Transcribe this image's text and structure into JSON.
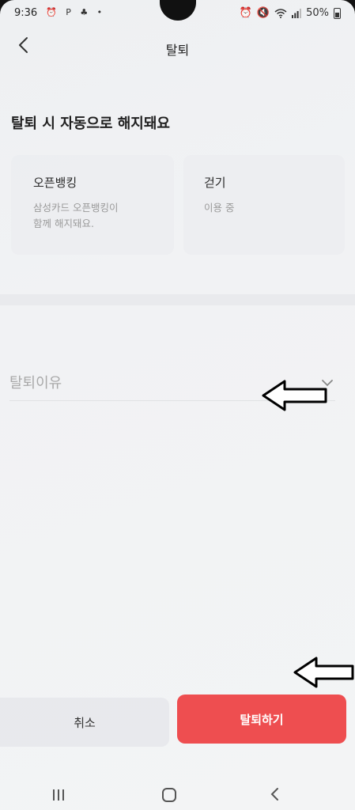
{
  "status_bar": {
    "time": "9:36",
    "left_icons": "⏰ P ♣ •",
    "battery_text": "50%"
  },
  "header": {
    "title": "탈퇴"
  },
  "notice": {
    "title": "탈퇴 시 자동으로 해지돼요"
  },
  "cards": [
    {
      "title": "오픈뱅킹",
      "desc_line1": "삼성카드 오픈뱅킹이",
      "desc_line2": "함께 해지돼요."
    },
    {
      "title": "걷기",
      "desc_line1": "이용 중",
      "desc_line2": ""
    }
  ],
  "reason": {
    "label": "탈퇴이유"
  },
  "buttons": {
    "cancel": "취소",
    "withdraw": "탈퇴하기"
  },
  "colors": {
    "accent": "#ee4e50",
    "background": "#f1f2f4"
  },
  "icons": {
    "back": "chevron-left-icon",
    "dropdown": "chevron-down-icon"
  }
}
